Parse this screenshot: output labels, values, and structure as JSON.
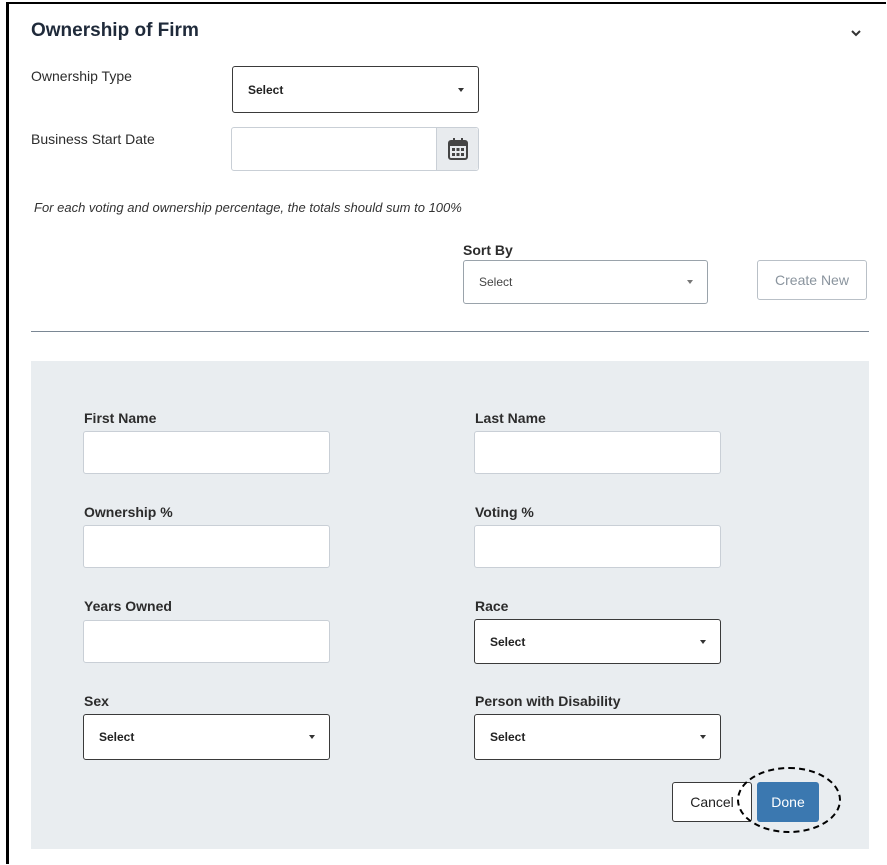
{
  "section": {
    "title": "Ownership of Firm",
    "collapse_icon": "chevron-down-icon"
  },
  "ownership_type": {
    "label": "Ownership Type",
    "value": "Select"
  },
  "business_start_date": {
    "label": "Business Start Date",
    "value": "",
    "icon": "calendar-icon"
  },
  "hint": "For each voting and ownership percentage, the totals should sum to 100%",
  "sort_by": {
    "label": "Sort By",
    "value": "Select"
  },
  "create_new": "Create New",
  "owner_form": {
    "first_name": {
      "label": "First Name",
      "value": ""
    },
    "last_name": {
      "label": "Last Name",
      "value": ""
    },
    "ownership_pct": {
      "label": "Ownership %",
      "value": ""
    },
    "voting_pct": {
      "label": "Voting %",
      "value": ""
    },
    "years_owned": {
      "label": "Years Owned",
      "value": ""
    },
    "race": {
      "label": "Race",
      "value": "Select"
    },
    "sex": {
      "label": "Sex",
      "value": "Select"
    },
    "disability": {
      "label": "Person with Disability",
      "value": "Select"
    },
    "cancel": "Cancel",
    "done": "Done"
  },
  "colors": {
    "primary_button": "#3b78b0",
    "panel_background": "#e9edf0",
    "title_text": "#1f2a3a"
  }
}
